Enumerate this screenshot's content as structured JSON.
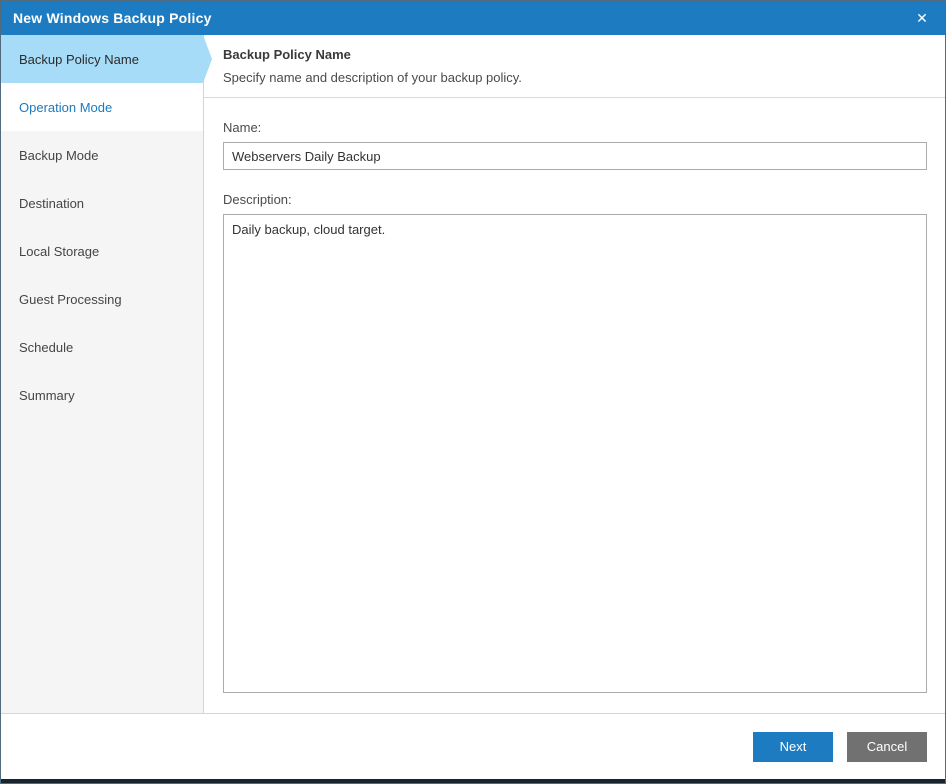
{
  "window": {
    "title": "New Windows Backup Policy",
    "close_glyph": "✕"
  },
  "sidebar": {
    "items": [
      {
        "label": "Backup Policy Name",
        "state": "active"
      },
      {
        "label": "Operation Mode",
        "state": "enabled"
      },
      {
        "label": "Backup Mode",
        "state": "disabled"
      },
      {
        "label": "Destination",
        "state": "disabled"
      },
      {
        "label": "Local Storage",
        "state": "disabled"
      },
      {
        "label": "Guest Processing",
        "state": "disabled"
      },
      {
        "label": "Schedule",
        "state": "disabled"
      },
      {
        "label": "Summary",
        "state": "disabled"
      }
    ]
  },
  "content": {
    "heading": "Backup Policy Name",
    "subheading": "Specify name and description of your backup policy.",
    "name_label": "Name:",
    "name_value": "Webservers Daily Backup",
    "description_label": "Description:",
    "description_value": "Daily backup, cloud target."
  },
  "footer": {
    "next_label": "Next",
    "cancel_label": "Cancel"
  },
  "colors": {
    "titlebar": "#1d7cc1",
    "active_step_bg": "#a6dcf7",
    "step_link_blue": "#1b7ac0",
    "next_button": "#1d7cc1",
    "cancel_button": "#717171",
    "bottom_edge": "#16242e"
  }
}
